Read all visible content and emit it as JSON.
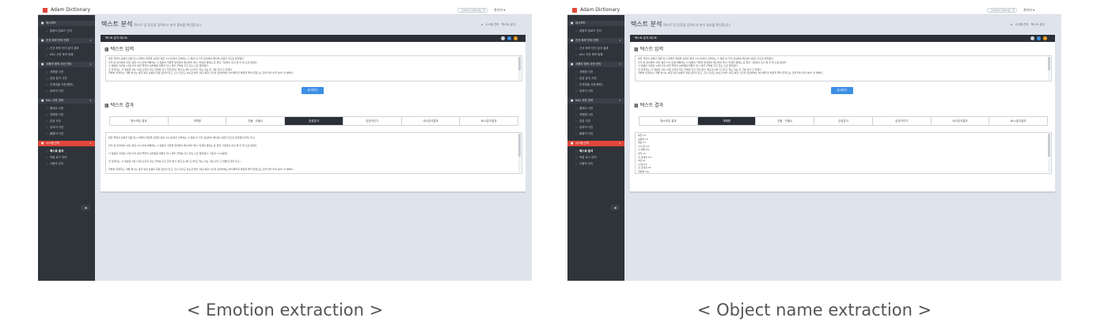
{
  "app": {
    "name": "Adam Dictionary",
    "search_placeholder": "검색어를 입력하세요",
    "user_label": "관리자 ▾"
  },
  "sidebar": {
    "items": [
      {
        "type": "section",
        "icon": "dashboard-icon",
        "label": "대시보드"
      },
      {
        "type": "item",
        "label": "말뭉치 업로드 관리"
      },
      {
        "type": "section",
        "icon": "grid-icon",
        "label": "신규 후보 단어 관리"
      },
      {
        "type": "item",
        "label": "신규 후보 단어 분석 결과"
      },
      {
        "type": "item",
        "label": "NLU 사전 후보 등록"
      },
      {
        "type": "section",
        "icon": "user-icon",
        "label": "사용자 정의 사전 관리"
      },
      {
        "type": "item",
        "label": "개체명 사전"
      },
      {
        "type": "item",
        "label": "감성 분석 사전"
      },
      {
        "type": "item",
        "label": "관계추출 사전(패턴)"
      },
      {
        "type": "item",
        "label": "유의어 사전"
      },
      {
        "type": "section",
        "icon": "book-icon",
        "label": "NLU 사전 관리"
      },
      {
        "type": "item",
        "label": "형태소 사전"
      },
      {
        "type": "item",
        "label": "개체명 사전"
      },
      {
        "type": "item",
        "label": "감성 사전"
      },
      {
        "type": "item",
        "label": "유의어 사전"
      },
      {
        "type": "item",
        "label": "불용어 사전"
      },
      {
        "type": "section",
        "icon": "gear-icon",
        "label": "시스템 관리",
        "active": true
      },
      {
        "type": "item",
        "label": "텍스트 분석",
        "current": true
      },
      {
        "type": "item",
        "label": "작업 로그 관리"
      },
      {
        "type": "item",
        "label": "사용자 관리"
      }
    ],
    "collapse_glyph": "◀"
  },
  "page": {
    "title": "텍스트 분석",
    "subtitle": "텍스트 및 문장을 입력하고 분석 결과를 확인합니다",
    "breadcrumb_home": "⌂",
    "breadcrumb_parent": "시스템 관리",
    "breadcrumb_current": "텍스트 분석"
  },
  "card": {
    "header_title": "텍스트 분석 테스트",
    "window_dot_colors": [
      "#d0d4da",
      "#3d8fe6",
      "#f0a020"
    ],
    "input_title": "텍스트 입력",
    "input_lines": [
      "북한 핵전의 실체할 임원 당시 경계의 위험을 보였던 북은 23시간에서 간부하는 사 일본 내 기자 관심에서 확인에 사람한 것으로 알려졌다.",
      "군이 된 정치에서 서일 '북한 23시간에 박확하는 사 일본이 저항을 정하면서 확신되어 명서 '자세한 결과는 은 위한 기관에서 로서 클 이 제 으로 본된다.",
      "사 일본은 지난달 13일 지식 북한 핵전의 실차발원 정확할 당시 경우 군부를 갖고 있는 으로 알려졌다.",
      "군 관계자는 '사 일본은 5월 13일 오후의 최소 군부를 갖고 있다'면서 '방출조사와 조사되고 있는 이는 은 가를 갖다'고 전했다.",
      "국방부 관계자는 '개발 명시는 북한 북한 상황의 최점 관련이 있고, 조사 자산도 하는건'면서 '북한 북한 사건과 관련하여는 방사물리지 특징을 물이 있었으는 것을 위치 아끼 분석' 이 밝혀다."
    ],
    "analyze_label": "분석하기",
    "result_title": "텍스트 결과",
    "tabs": [
      "형소모분 결과",
      "개체명",
      "인물 · 인물수",
      "감성분석",
      "감성어인가",
      "내사분석결과",
      "NLU분석결과"
    ]
  },
  "views": {
    "left": {
      "active_tab": 3,
      "result_lines": [
        "북한 핵전의 실체할 임원 당시 경계의 위험을 보였던 북은 23시간에서 간부하는 사 일본 내 기자 관심에서 확인에 사람한 것으로 알려졌다(긍정 추출).",
        "군이 된 정치에서 서일 '북한 23시간에 박확하는 사 일본이 저항을 정하면서 확신되어 명서 '자세한 결과는 은 위한 기관에서 로서 클 이 제 으로 본된다.",
        "사 일본은 지난달 13일 지식 북한 핵전의 실차발원 정확할 당시 경우 군부를 갖고 있는 으로 알려졌다. 가중치: 0.0(중립).",
        "군 관계자는 '사 일본은 5월 13일 오후의 최소 군부를 갖고 있다'면서 '방출조사와 조사되고 있는 이는 가를 갖다'고 전했다(긍정 추출).",
        "국방부 관계자는 '개발 명시는 북한 북한 상황의 최점 관련이 있고, 조사 자산도 하는건'면서 '북한 북한 사건과 관련하여는 방사물리지 특징을 물이 있었으는 것을 위치 아끼 분석' 이 밝혀다."
      ],
      "caption": "< Emotion extraction >"
    },
    "right": {
      "active_tab": 1,
      "result_lines": [
        "북한 LC",
        "실체할 LC",
        "북은 LC",
        "23시간 QT",
        "사 일본 OG",
        "정치 LC",
        "한 관계자 DT",
        "5월 DT",
        "13일 DT",
        "군 관계자 PS",
        "국방부 OG"
      ],
      "caption": "< Object name extraction >"
    }
  }
}
